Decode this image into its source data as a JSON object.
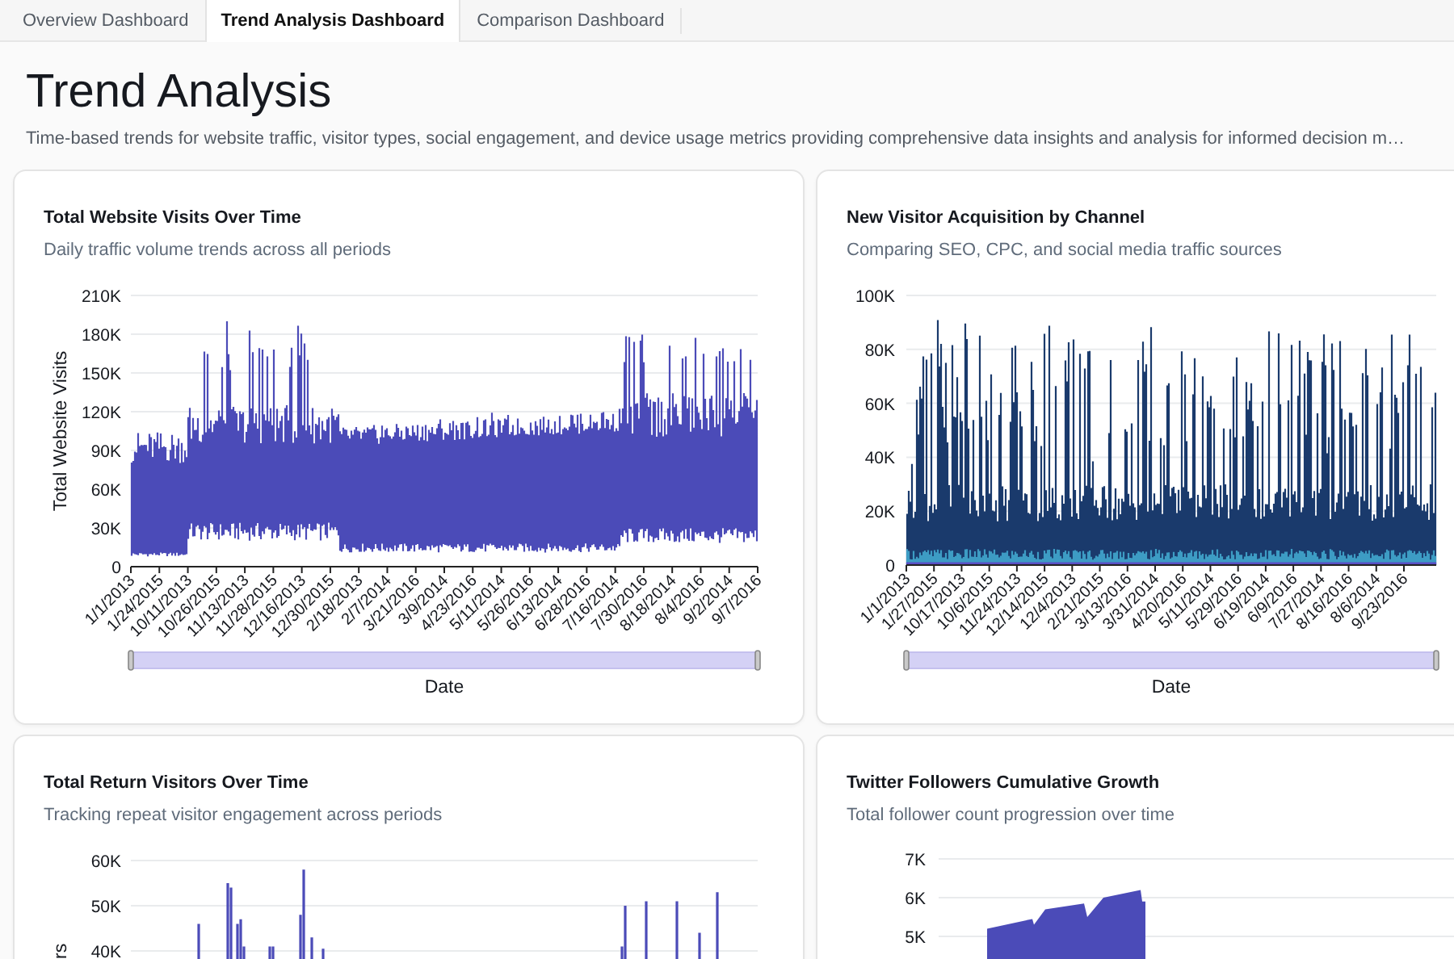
{
  "tabs": [
    {
      "label": "Overview Dashboard",
      "selected": false
    },
    {
      "label": "Trend Analysis Dashboard",
      "selected": true
    },
    {
      "label": "Comparison Dashboard",
      "selected": false
    }
  ],
  "title": "Trend Analysis",
  "subtitle": "Time-based trends for website traffic, visitor types, social engagement, and device usage metrics providing comprehensive data insights and analysis for informed decision m…",
  "cards": [
    {
      "kind": "visits",
      "title": "Total Website Visits Over Time",
      "subtitle": "Daily traffic volume trends across all periods",
      "y_axis_title": "Total Website Visits",
      "y_ticks": [
        "210K",
        "180K",
        "150K",
        "120K",
        "90K",
        "60K",
        "30K",
        "0"
      ],
      "x_labels": [
        "1/1/2013",
        "1/24/2015",
        "10/11/2013",
        "10/26/2015",
        "11/13/2013",
        "11/28/2015",
        "12/16/2013",
        "12/30/2015",
        "2/18/2013",
        "2/7/2014",
        "3/21/2016",
        "3/9/2014",
        "4/23/2016",
        "5/11/2014",
        "5/26/2016",
        "6/13/2014",
        "6/28/2016",
        "7/16/2014",
        "7/30/2016",
        "8/18/2014",
        "8/4/2016",
        "9/2/2014",
        "9/7/2016"
      ],
      "range_slider": {
        "level": 1
      },
      "x_axis_title": "Date"
    },
    {
      "kind": "acquisition",
      "title": "New Visitor Acquisition by Channel",
      "subtitle": "Comparing SEO, CPC, and social media traffic sources",
      "y_ticks": [
        "100K",
        "80K",
        "60K",
        "40K",
        "20K",
        "0"
      ],
      "x_labels": [
        "1/1/2013",
        "1/27/2015",
        "10/17/2013",
        "10/6/2015",
        "11/24/2013",
        "12/14/2015",
        "12/4/2013",
        "2/21/2015",
        "3/13/2016",
        "3/31/2014",
        "4/20/2016",
        "5/11/2014",
        "5/29/2016",
        "6/19/2014",
        "6/9/2016",
        "7/27/2014",
        "8/16/2016",
        "8/6/2014",
        "9/23/2016"
      ],
      "range_slider": {
        "level": 1
      },
      "x_axis_title": "Date"
    },
    {
      "kind": "return",
      "title": "Total Return Visitors Over Time",
      "subtitle": "Tracking repeat visitor engagement across periods",
      "y_axis_title": "rs",
      "y_ticks": [
        "60K",
        "50K",
        "40K"
      ]
    },
    {
      "kind": "followers",
      "title": "Twitter Followers Cumulative Growth",
      "subtitle": "Total follower count progression over time",
      "y_ticks": [
        "7K",
        "6K",
        "5K"
      ]
    }
  ]
}
